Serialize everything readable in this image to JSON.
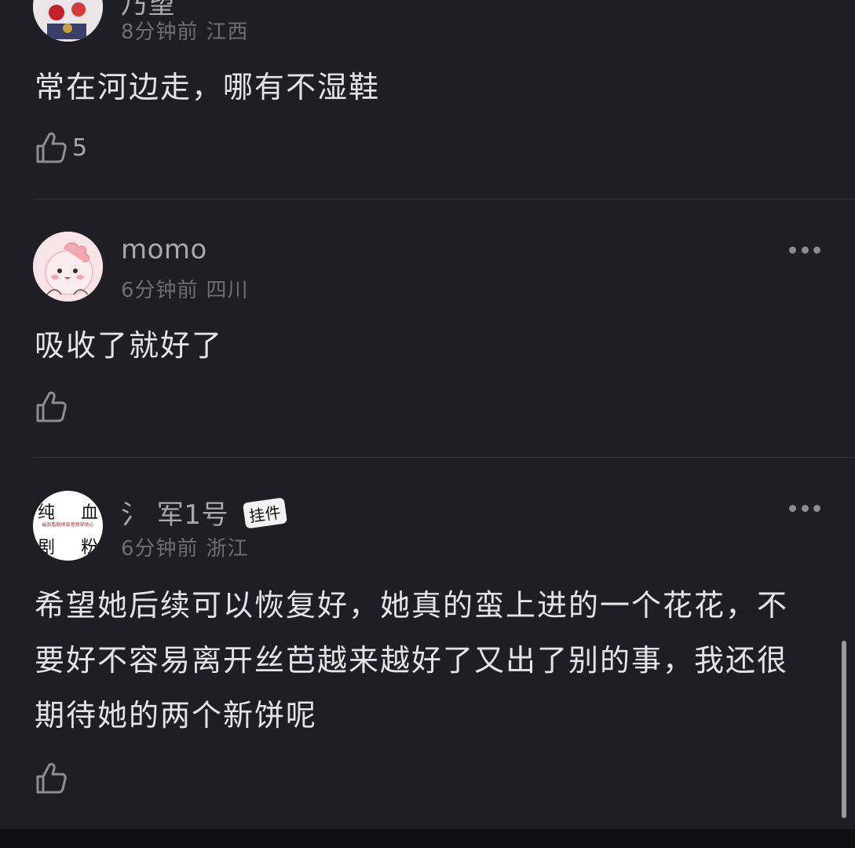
{
  "comments": [
    {
      "username": "乃望",
      "time": "8分钟前",
      "location": "江西",
      "text": "常在河边走，哪有不湿鞋",
      "likes": "5"
    },
    {
      "username": "momo",
      "time": "6分钟前",
      "location": "四川",
      "text": "吸收了就好了",
      "likes": ""
    },
    {
      "username": "氵 军1号",
      "badge": "挂件",
      "time": "6分钟前",
      "location": "浙江",
      "text": "希望她后续可以恢复好，她真的蛮上进的一个花花，不要好不容易离开丝芭越来越好了又出了别的事，我还很期待她的两个新饼呢",
      "likes": "",
      "avatar_text": {
        "tl": "纯",
        "tr": "血",
        "middle": "最我看剧体会者频穿地心",
        "bl": "剧",
        "br": "粉"
      }
    }
  ],
  "colors": {
    "background": "#1f1e24",
    "text_primary": "#e4e4e6",
    "text_secondary": "#6e6d74",
    "username": "#a9a8ae",
    "divider": "#34333a"
  },
  "icons": {
    "like": "thumbs-up-icon",
    "more": "more-dots-icon"
  }
}
